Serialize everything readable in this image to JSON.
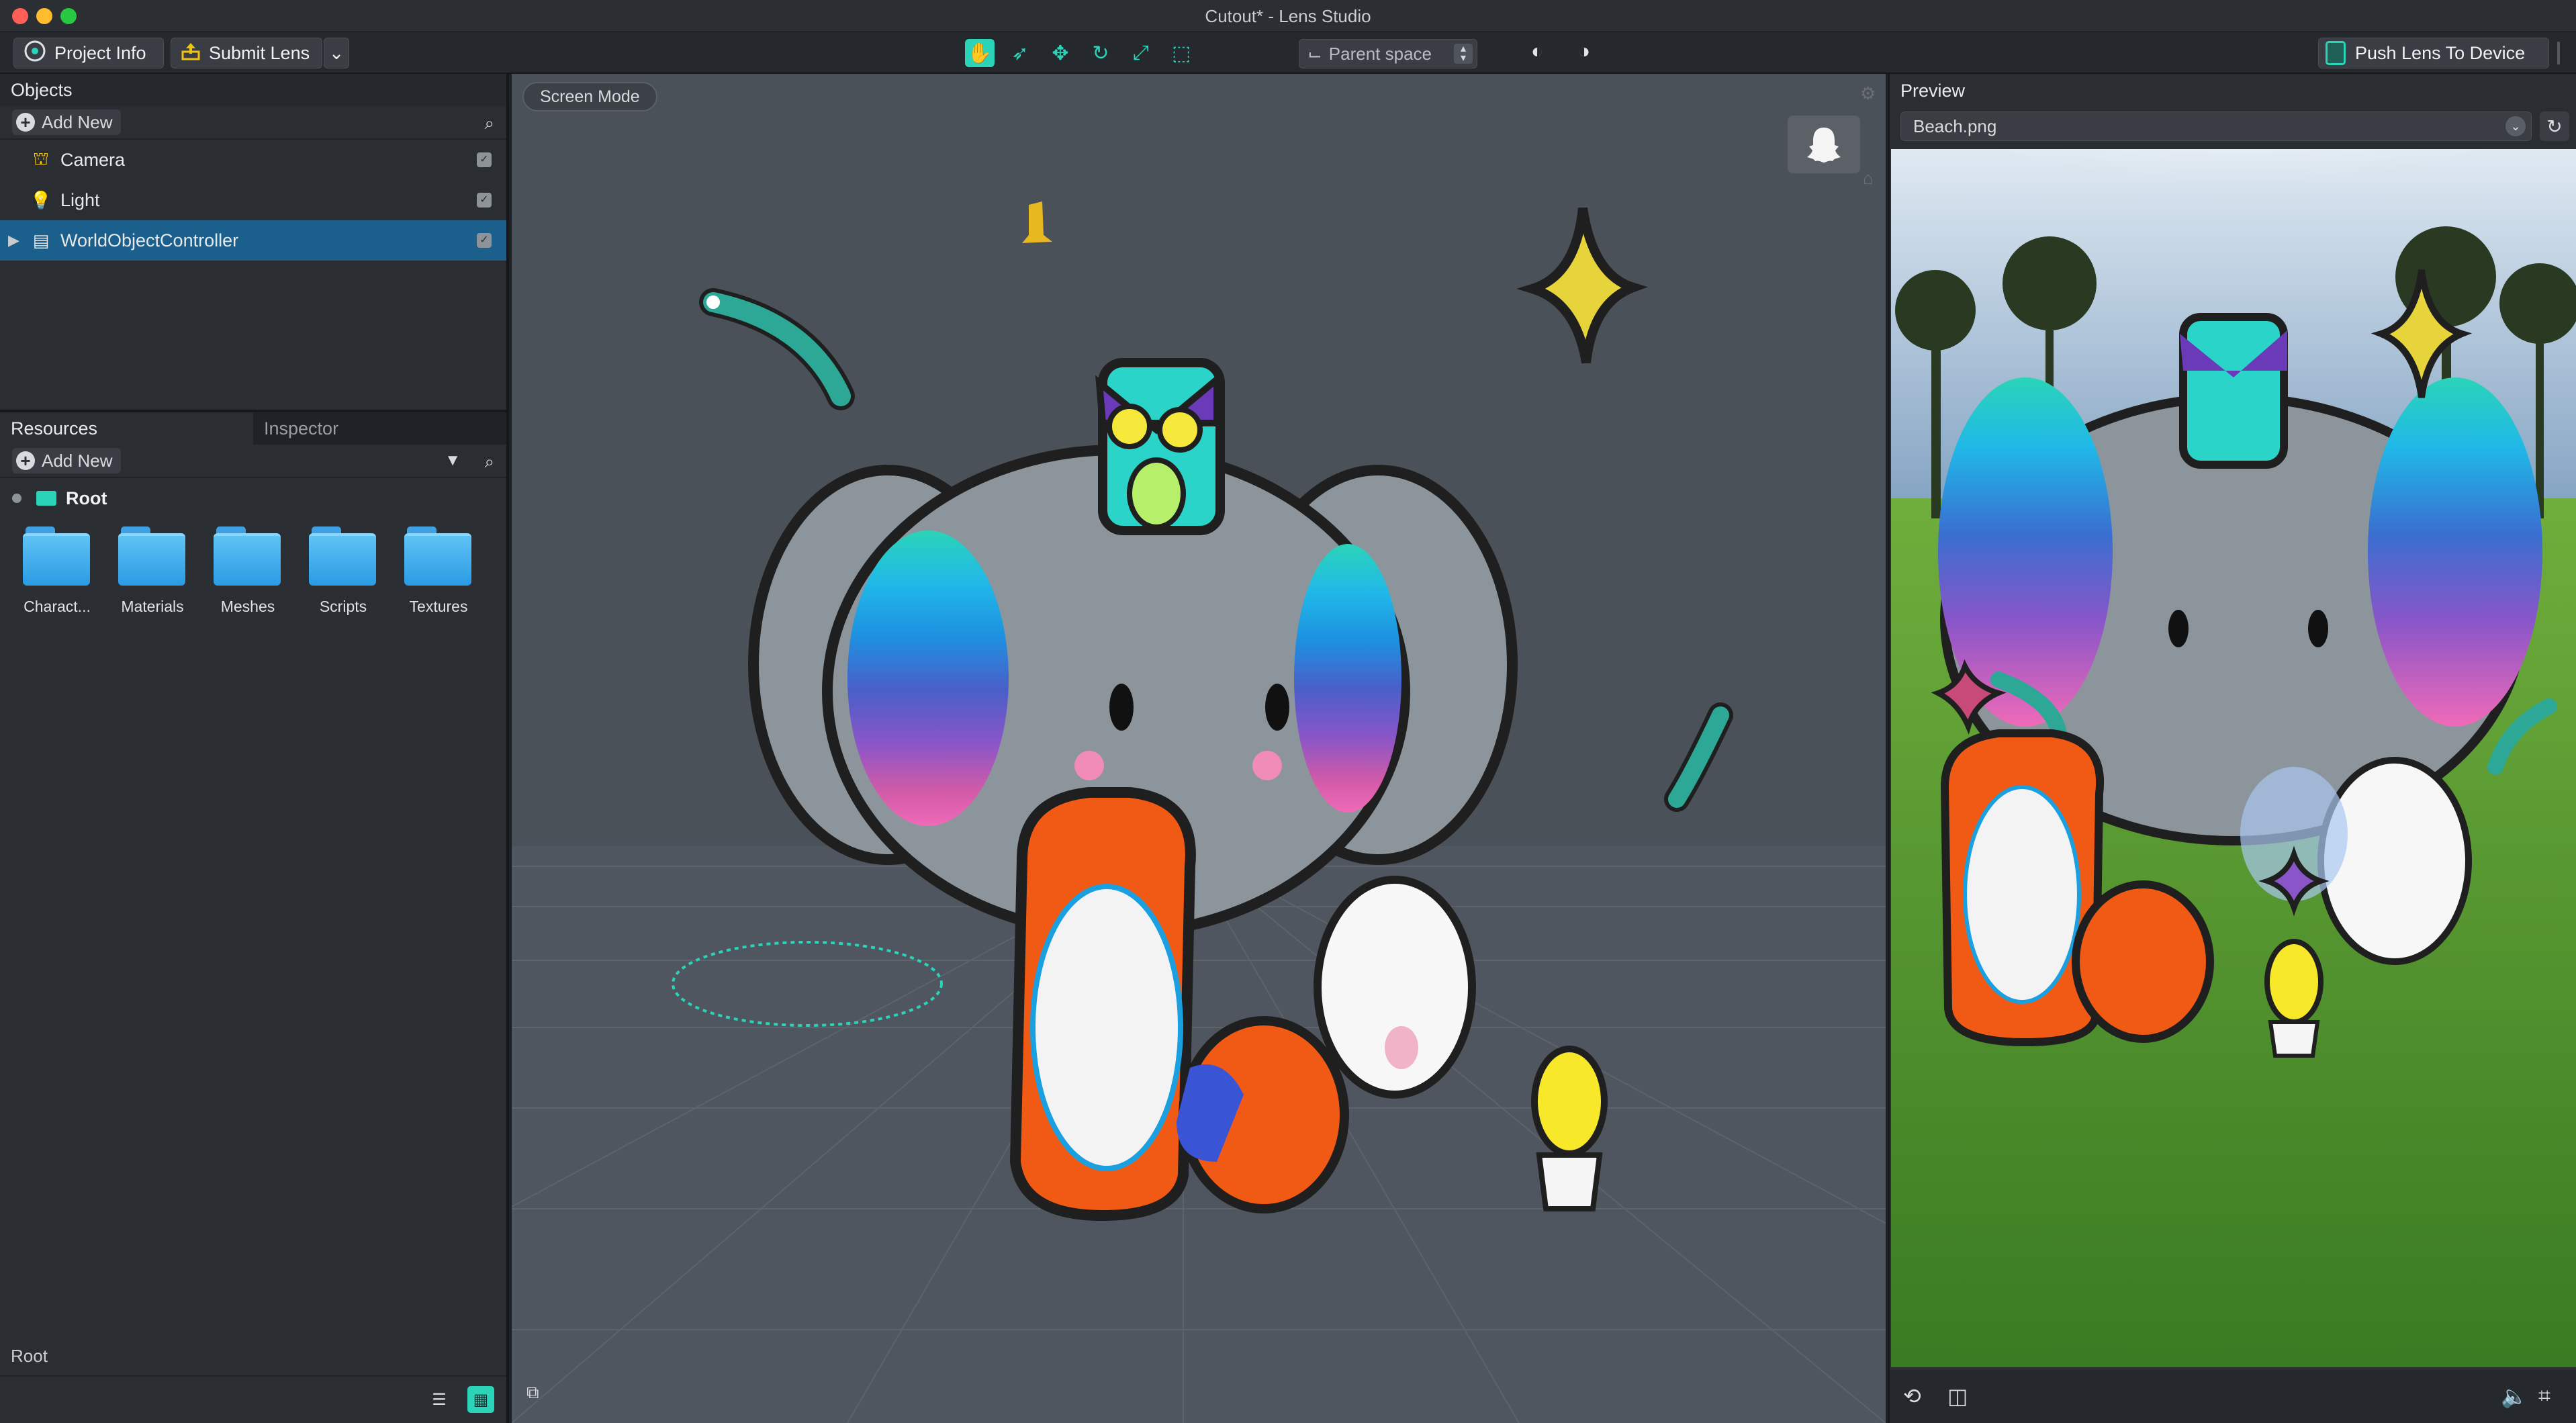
{
  "window": {
    "title": "Cutout* - Lens Studio"
  },
  "toolbar": {
    "project_info_label": "Project Info",
    "submit_lens_label": "Submit Lens",
    "parent_space_label": "Parent space",
    "push_lens_label": "Push Lens To Device",
    "accent_color": "#2bd4b8"
  },
  "objects_panel": {
    "title": "Objects",
    "add_new_label": "Add New",
    "items": [
      {
        "label": "Camera",
        "icon": "camera-icon",
        "checked": true,
        "selected": false
      },
      {
        "label": "Light",
        "icon": "light-bulb-icon",
        "checked": true,
        "selected": false
      },
      {
        "label": "WorldObjectController",
        "icon": "script-icon",
        "checked": true,
        "selected": true
      }
    ]
  },
  "resources_panel": {
    "tabs": [
      "Resources",
      "Inspector"
    ],
    "active_tab": "Resources",
    "add_new_label": "Add New",
    "root_label": "Root",
    "folders": [
      "Charact...",
      "Materials",
      "Meshes",
      "Scripts",
      "Textures"
    ],
    "footer_label": "Root"
  },
  "viewport": {
    "screen_mode_label": "Screen Mode",
    "background_color": "#4b5158"
  },
  "preview": {
    "title": "Preview",
    "image_select_value": "Beach.png"
  }
}
